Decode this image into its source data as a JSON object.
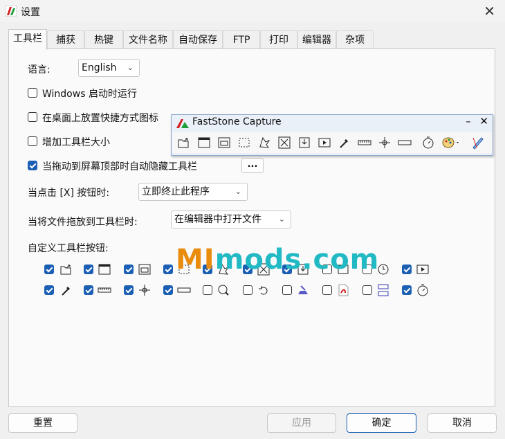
{
  "window": {
    "title": "设置",
    "close_glyph": "✕"
  },
  "tabs": [
    {
      "label": "工具栏",
      "active": true
    },
    {
      "label": "捕获"
    },
    {
      "label": "热键"
    },
    {
      "label": "文件名称"
    },
    {
      "label": "自动保存"
    },
    {
      "label": "FTP"
    },
    {
      "label": "打印"
    },
    {
      "label": "编辑器"
    },
    {
      "label": "杂项"
    }
  ],
  "toolbar_tab": {
    "language_label": "语言:",
    "language_value": "English",
    "options": [
      {
        "label": "Windows 启动时运行",
        "checked": false
      },
      {
        "label": "在桌面上放置快捷方式图标",
        "checked": false
      },
      {
        "label": "增加工具栏大小",
        "checked": false
      },
      {
        "label": "当拖动到屏幕顶部时自动隐藏工具栏",
        "checked": true
      }
    ],
    "more_button": "...",
    "close_click_label": "当点击 [X] 按钮时:",
    "close_click_value": "立即终止此程序",
    "drop_file_label": "当将文件拖放到工具栏时:",
    "drop_file_value": "在编辑器中打开文件",
    "custom_buttons_label": "自定义工具栏按钮:",
    "custom_buttons": [
      [
        {
          "icon": "open-folder-icon",
          "checked": true
        },
        {
          "icon": "active-window-icon",
          "checked": true
        },
        {
          "icon": "window-object-icon",
          "checked": true
        },
        {
          "icon": "rectangle-region-icon",
          "checked": true
        },
        {
          "icon": "freehand-region-icon",
          "checked": true
        },
        {
          "icon": "fullscreen-icon",
          "checked": true
        },
        {
          "icon": "scrolling-window-icon",
          "checked": true
        },
        {
          "icon": "fixed-region-icon",
          "checked": false
        },
        {
          "icon": "delay-capture-icon",
          "checked": false
        },
        {
          "icon": "screen-recorder-icon",
          "checked": true
        }
      ],
      [
        {
          "icon": "color-picker-icon",
          "checked": true
        },
        {
          "icon": "ruler-icon",
          "checked": true
        },
        {
          "icon": "crosshair-icon",
          "checked": true
        },
        {
          "icon": "minimize-bar-icon",
          "checked": true
        },
        {
          "icon": "magnifier-icon",
          "checked": false
        },
        {
          "icon": "undo-arrow-icon",
          "checked": false
        },
        {
          "icon": "scanner-icon",
          "checked": false
        },
        {
          "icon": "pdf-icon",
          "checked": false
        },
        {
          "icon": "combine-icon",
          "checked": false
        },
        {
          "icon": "timer-icon",
          "checked": true
        }
      ]
    ]
  },
  "floating_toolbar": {
    "title": "FastStone Capture",
    "minimize_glyph": "–",
    "close_glyph": "✕",
    "icons": [
      "open-folder-icon",
      "active-window-icon",
      "window-object-icon",
      "rectangle-region-icon",
      "freehand-region-icon",
      "fullscreen-icon",
      "scrolling-window-icon",
      "screen-recorder-icon",
      "color-picker-icon",
      "ruler-icon",
      "crosshair-icon",
      "minimize-bar-icon",
      "timer-icon",
      "palette-menu-icon",
      "settings-pen-icon"
    ]
  },
  "watermark": {
    "part1": "MI",
    "part2": "mods.com"
  },
  "buttons": {
    "reset": "重置",
    "apply": "应用",
    "ok": "确定",
    "cancel": "取消"
  },
  "colors": {
    "accent": "#1a5fb4",
    "watermark_orange": "#e98b0c",
    "watermark_teal": "#21b9c4"
  }
}
